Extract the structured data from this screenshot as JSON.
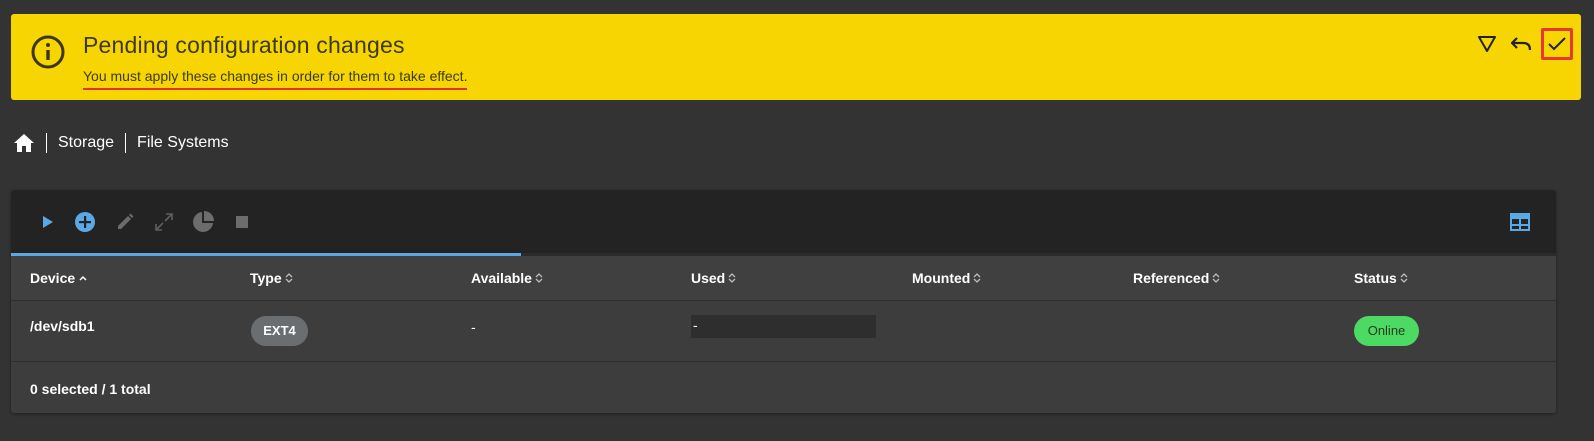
{
  "banner": {
    "title": "Pending configuration changes",
    "subtitle": "You must apply these changes in order for them to take effect.",
    "actions": [
      {
        "icon": "filter-icon"
      },
      {
        "icon": "undo-icon"
      },
      {
        "icon": "check-icon"
      }
    ],
    "color": "#f7d503"
  },
  "breadcrumb": {
    "home_icon": "home-icon",
    "items": [
      "Storage",
      "File Systems"
    ]
  },
  "toolbar": {
    "buttons": [
      "play-icon",
      "add-circle-icon",
      "pencil-icon",
      "expand-icon",
      "pie-chart-icon",
      "stop-icon"
    ],
    "right_button": "table-columns-icon",
    "progress": 0.33,
    "accent": "#5aa9e6"
  },
  "table": {
    "columns": [
      "Device",
      "Type",
      "Available",
      "Used",
      "Mounted",
      "Referenced",
      "Status"
    ],
    "rows": [
      {
        "device": "/dev/sdb1",
        "type": "EXT4",
        "available": "-",
        "used": "-",
        "mounted": "",
        "referenced": "",
        "status": "Online"
      }
    ],
    "footer": "0 selected / 1 total"
  }
}
